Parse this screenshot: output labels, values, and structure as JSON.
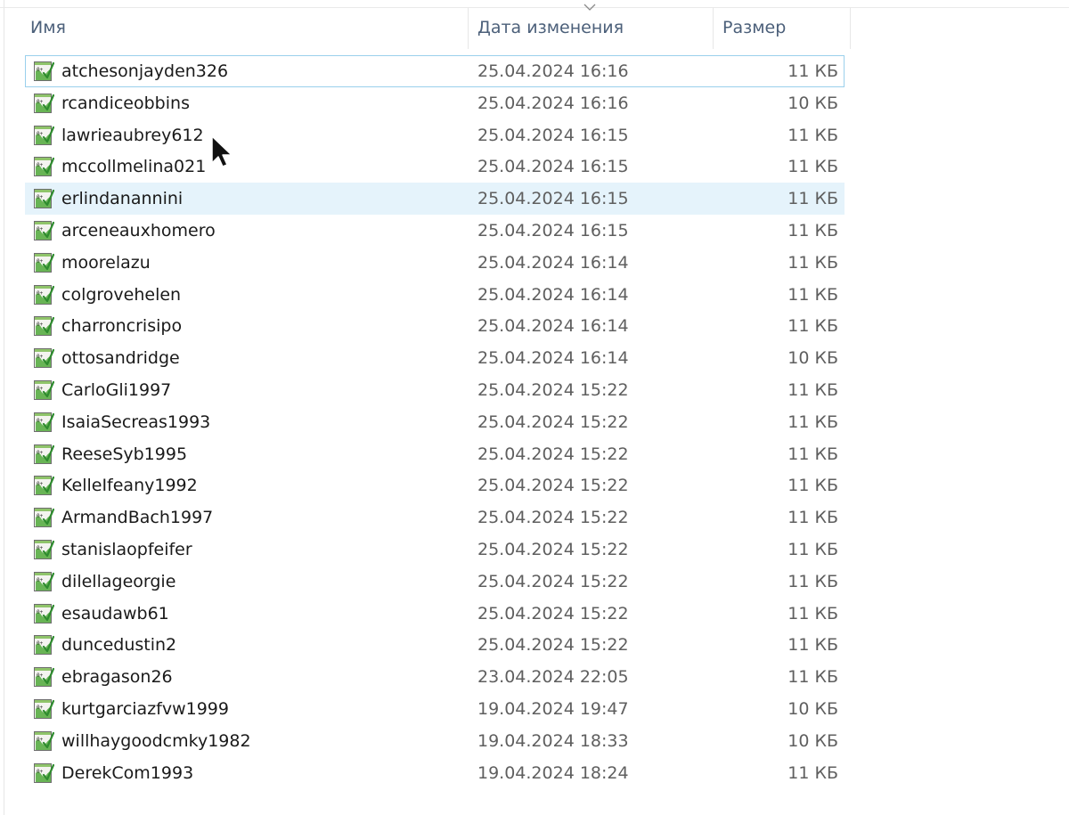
{
  "header": {
    "name": "Имя",
    "date": "Дата изменения",
    "size": "Размер"
  },
  "icons": {
    "file": "text-document-icon",
    "sort": "chevron-down-icon",
    "pointer": "mouse-pointer-icon"
  },
  "colors": {
    "header_text": "#4c607a",
    "hover_row": "#e5f3fb",
    "focus_border": "#9ad0ec"
  },
  "files": [
    {
      "name": "atchesonjayden326",
      "date": "25.04.2024 16:16",
      "size": "11 КБ"
    },
    {
      "name": "rcandiceobbins",
      "date": "25.04.2024 16:16",
      "size": "10 КБ"
    },
    {
      "name": "lawrieaubrey612",
      "date": "25.04.2024 16:15",
      "size": "11 КБ"
    },
    {
      "name": "mccollmelina021",
      "date": "25.04.2024 16:15",
      "size": "11 КБ"
    },
    {
      "name": "erlindanannini",
      "date": "25.04.2024 16:15",
      "size": "11 КБ"
    },
    {
      "name": "arceneauxhomero",
      "date": "25.04.2024 16:15",
      "size": "11 КБ"
    },
    {
      "name": "moorelazu",
      "date": "25.04.2024 16:14",
      "size": "11 КБ"
    },
    {
      "name": "colgrovehelen",
      "date": "25.04.2024 16:14",
      "size": "11 КБ"
    },
    {
      "name": "charroncrisipo",
      "date": "25.04.2024 16:14",
      "size": "11 КБ"
    },
    {
      "name": "ottosandridge",
      "date": "25.04.2024 16:14",
      "size": "10 КБ"
    },
    {
      "name": "CarloGli1997",
      "date": "25.04.2024 15:22",
      "size": "11 КБ"
    },
    {
      "name": "IsaiaSecreas1993",
      "date": "25.04.2024 15:22",
      "size": "11 КБ"
    },
    {
      "name": "ReeseSyb1995",
      "date": "25.04.2024 15:22",
      "size": "11 КБ"
    },
    {
      "name": "KelleIfeany1992",
      "date": "25.04.2024 15:22",
      "size": "11 КБ"
    },
    {
      "name": "ArmandBach1997",
      "date": "25.04.2024 15:22",
      "size": "11 КБ"
    },
    {
      "name": "stanislaopfeifer",
      "date": "25.04.2024 15:22",
      "size": "11 КБ"
    },
    {
      "name": "dilellageorgie",
      "date": "25.04.2024 15:22",
      "size": "11 КБ"
    },
    {
      "name": "esaudawb61",
      "date": "25.04.2024 15:22",
      "size": "11 КБ"
    },
    {
      "name": "duncedustin2",
      "date": "25.04.2024 15:22",
      "size": "11 КБ"
    },
    {
      "name": "ebragason26",
      "date": "23.04.2024 22:05",
      "size": "11 КБ"
    },
    {
      "name": "kurtgarciazfvw1999",
      "date": "19.04.2024 19:47",
      "size": "10 КБ"
    },
    {
      "name": "willhaygoodcmky1982",
      "date": "19.04.2024 18:33",
      "size": "10 КБ"
    },
    {
      "name": "DerekCom1993",
      "date": "19.04.2024 18:24",
      "size": "11 КБ"
    }
  ]
}
